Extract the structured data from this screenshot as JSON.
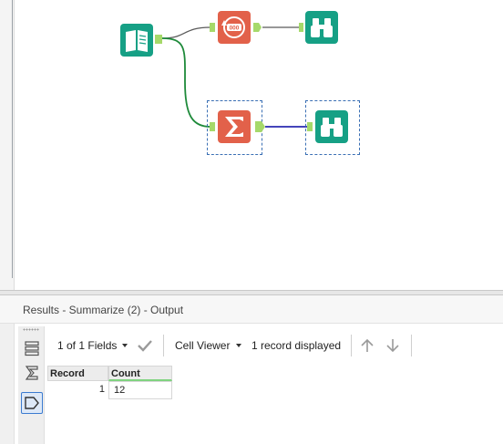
{
  "results": {
    "title": "Results - Summarize (2) - Output"
  },
  "toolbar": {
    "fields_label": "1 of 1 Fields",
    "cell_viewer_label": "Cell Viewer",
    "record_status": "1 record displayed"
  },
  "grid": {
    "columns": [
      "Record",
      "Count"
    ],
    "rows": [
      {
        "record": "1",
        "count": "12"
      }
    ]
  },
  "canvas_tools": [
    {
      "name": "input-data",
      "icon": "book-icon",
      "color": "#16a085"
    },
    {
      "name": "record-id",
      "icon": "counter-icon",
      "color": "#e2614a",
      "badge": "000"
    },
    {
      "name": "browse-1",
      "icon": "binoculars-icon",
      "color": "#16a085"
    },
    {
      "name": "summarize",
      "icon": "sigma-icon",
      "color": "#e2614a"
    },
    {
      "name": "browse-2",
      "icon": "binoculars-icon",
      "color": "#16a085"
    }
  ],
  "colors": {
    "accent_green": "#16a085",
    "accent_orange": "#e2614a",
    "connector_green": "#1e8a3a",
    "connector_blue": "#2a2ab0",
    "anchor_green": "#a6d96a",
    "selection_blue": "#3a6fb4"
  }
}
